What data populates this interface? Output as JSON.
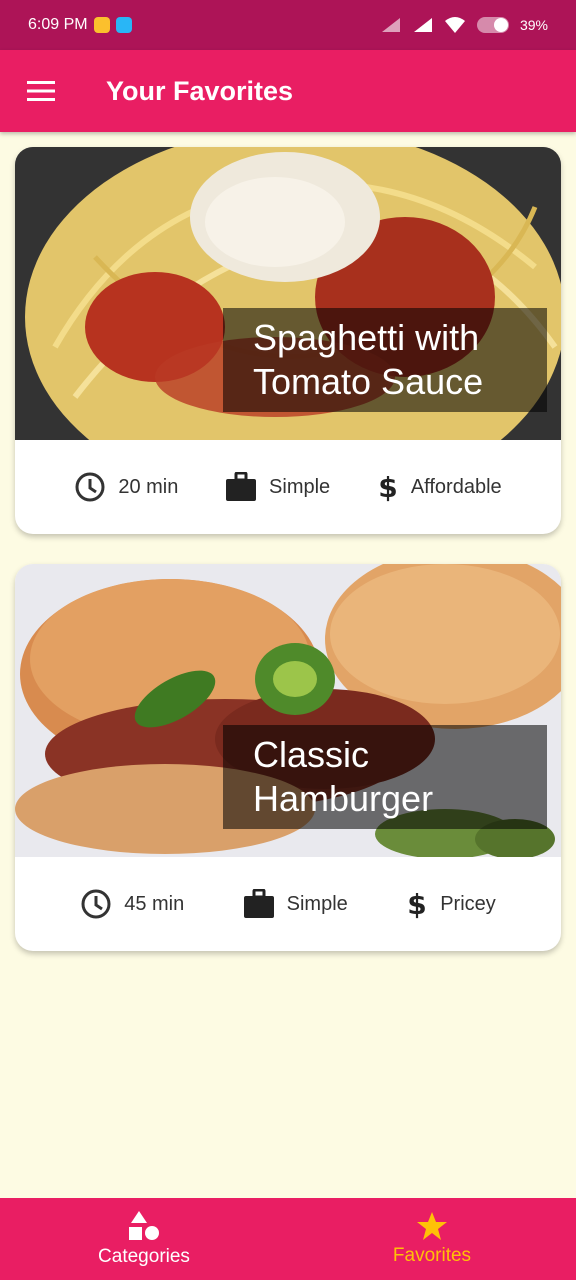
{
  "status_bar": {
    "time": "6:09 PM",
    "battery": "39%"
  },
  "app_bar": {
    "title": "Your Favorites",
    "menu_icon": "menu-icon"
  },
  "meals": [
    {
      "title": "Spaghetti with Tomato Sauce",
      "duration": "20 min",
      "complexity": "Simple",
      "affordability": "Affordable"
    },
    {
      "title": "Classic Hamburger",
      "duration": "45 min",
      "complexity": "Simple",
      "affordability": "Pricey"
    }
  ],
  "bottom_nav": {
    "items": [
      {
        "label": "Categories",
        "icon": "categories-icon",
        "active": false
      },
      {
        "label": "Favorites",
        "icon": "star-icon",
        "active": true
      }
    ]
  },
  "colors": {
    "primary": "#e91e63",
    "status_bar": "#ad1457",
    "accent": "#ffc107",
    "background": "#fdfbe3"
  }
}
